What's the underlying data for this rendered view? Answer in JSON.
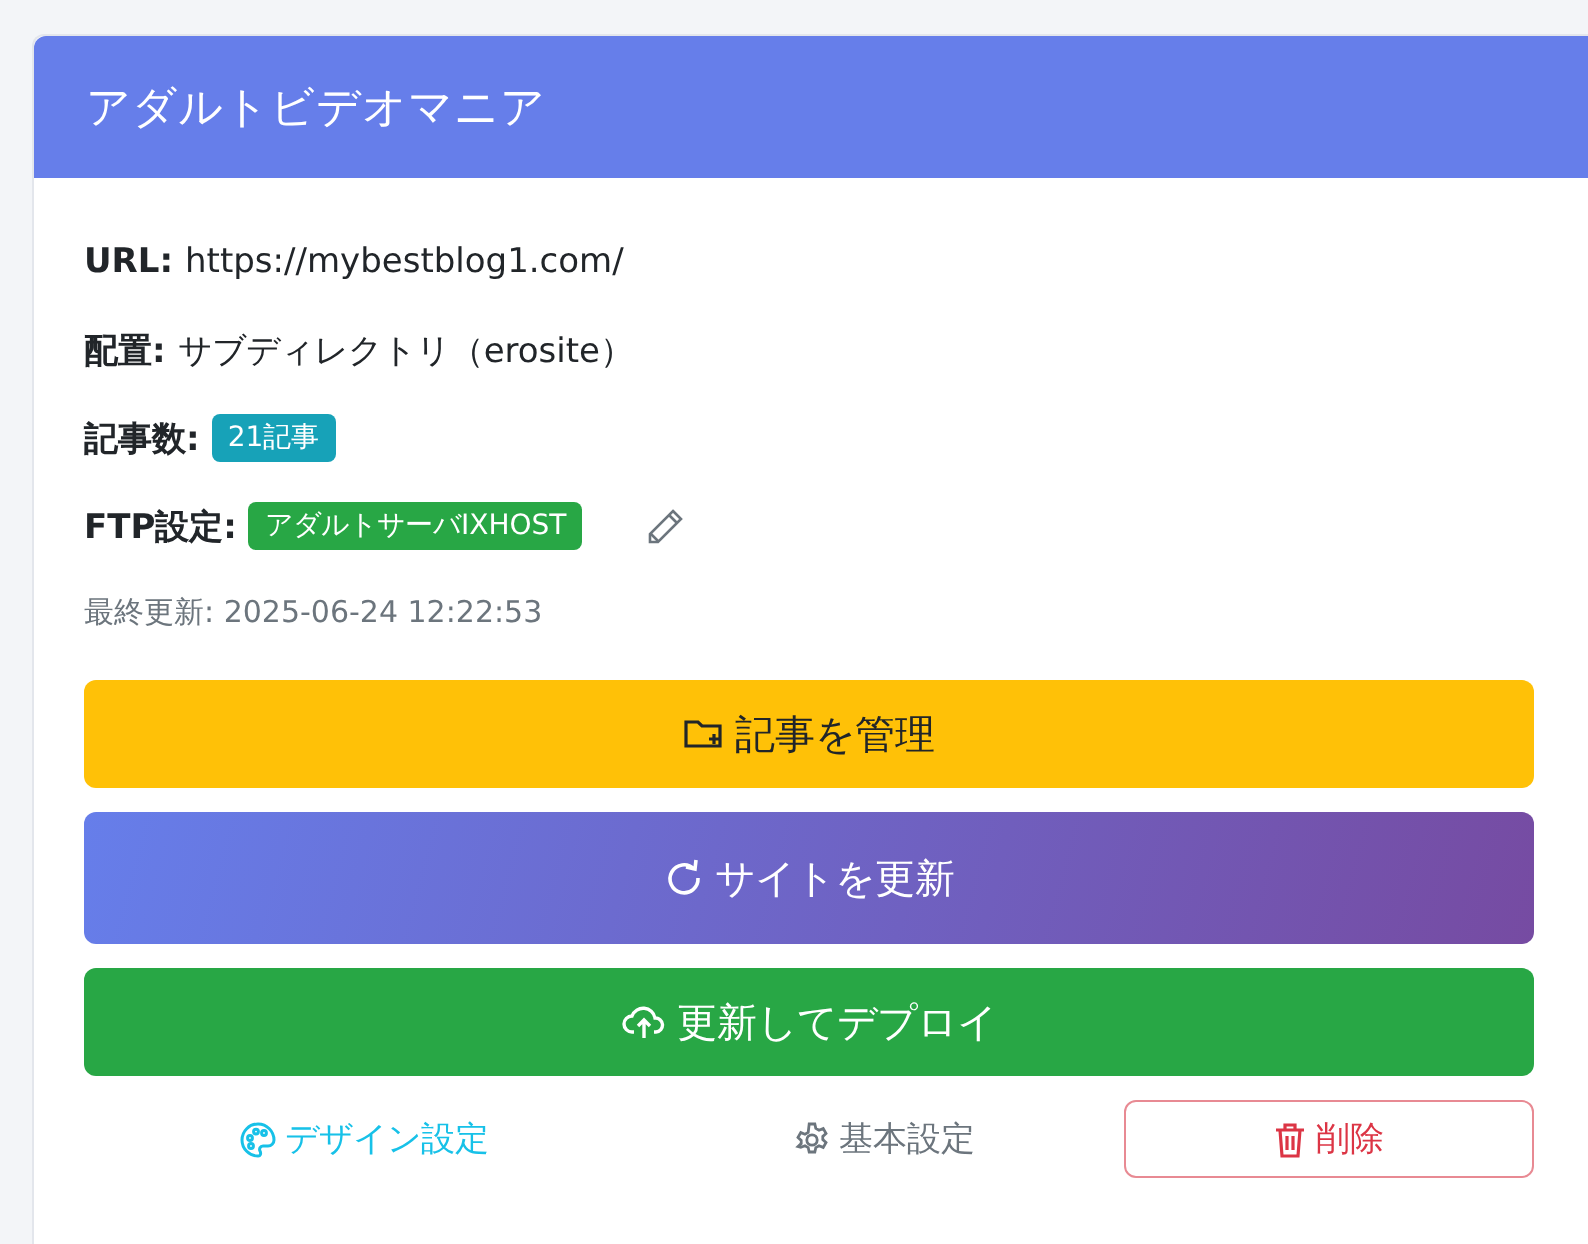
{
  "card": {
    "title": "アダルトビデオマニア",
    "fields": [
      {
        "label": "URL:",
        "kind": "text",
        "value": "https://mybestblog1.com/",
        "edit": false
      },
      {
        "label": "配置:",
        "kind": "text",
        "value": "サブディレクトリ（erosite）",
        "edit": false
      },
      {
        "label": "記事数:",
        "kind": "badge",
        "value": "21記事",
        "color": "#17a2b8",
        "edit": false
      },
      {
        "label": "FTP設定:",
        "kind": "badge",
        "value": "アダルトサーバIXHOST",
        "color": "#28a745",
        "edit": true
      }
    ],
    "updated": "最終更新: 2025-06-24 12:22:53",
    "actions": [
      {
        "label": "記事を管理",
        "kind": "warning"
      },
      {
        "label": "サイトを更新",
        "kind": "gradient"
      },
      {
        "label": "更新してデプロイ",
        "kind": "success"
      }
    ],
    "links": [
      {
        "label": "デザイン設定",
        "kind": "info"
      },
      {
        "label": "基本設定",
        "kind": "secondary"
      },
      {
        "label": "削除",
        "kind": "danger"
      }
    ]
  }
}
